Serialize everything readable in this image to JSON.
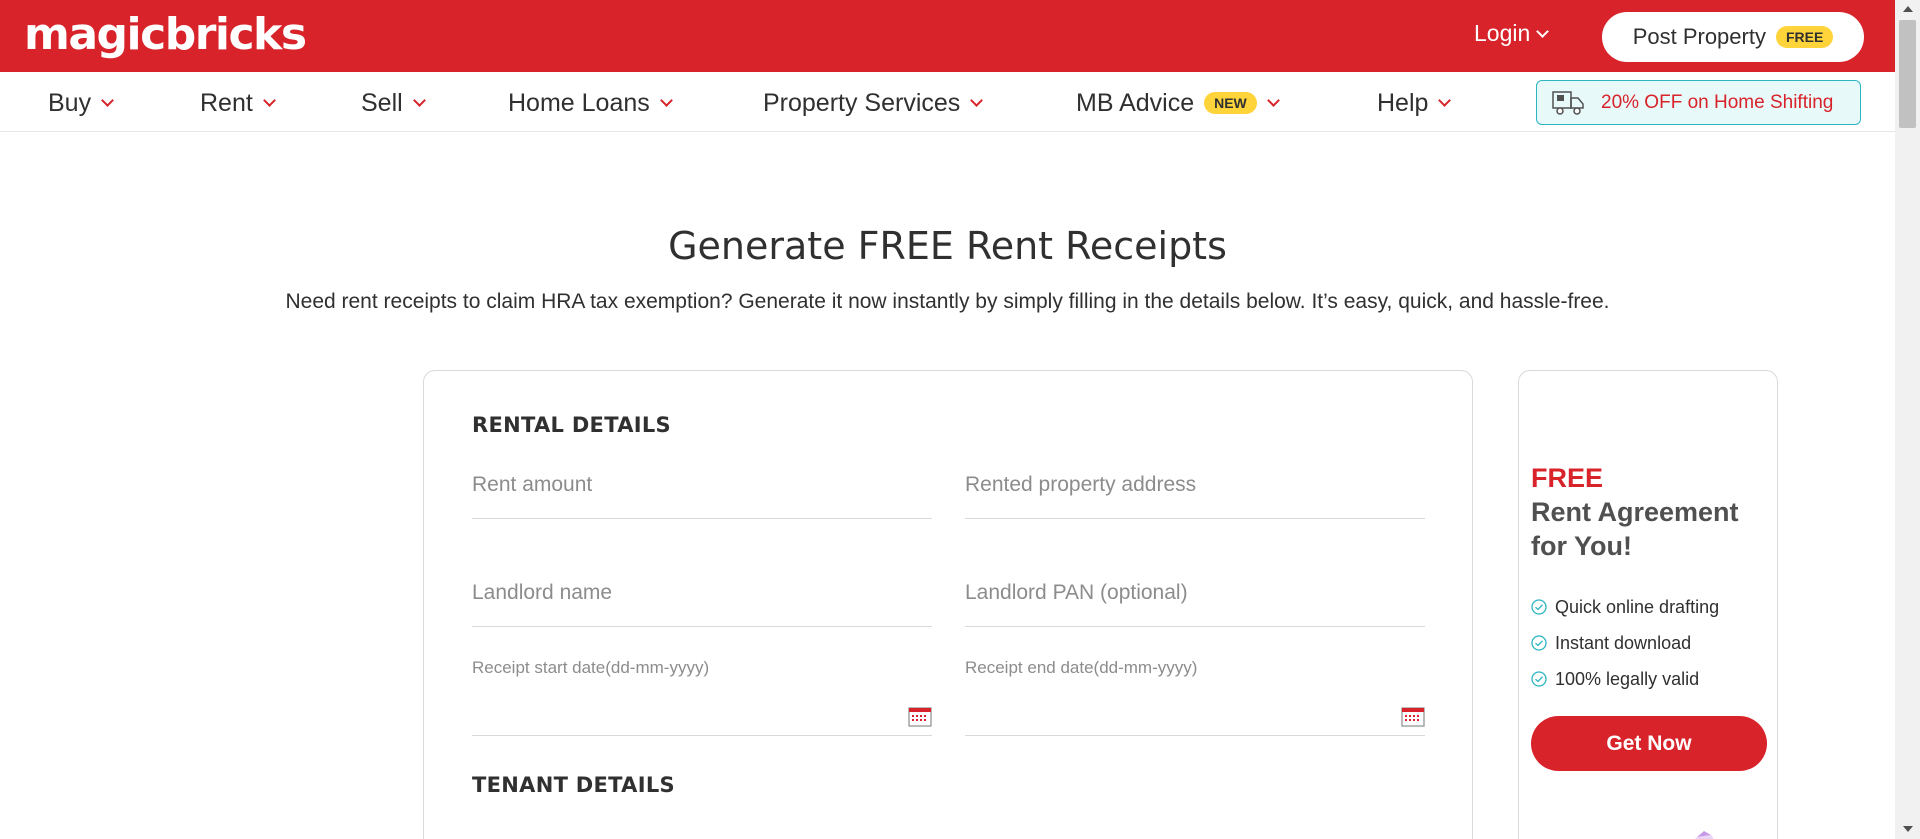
{
  "header": {
    "logo": "magicbricks",
    "login_label": "Login",
    "post_property_label": "Post Property",
    "post_property_badge": "FREE"
  },
  "nav": {
    "items": [
      {
        "label": "Buy"
      },
      {
        "label": "Rent"
      },
      {
        "label": "Sell"
      },
      {
        "label": "Home Loans"
      },
      {
        "label": "Property Services"
      },
      {
        "label": "MB Advice",
        "badge": "NEW"
      },
      {
        "label": "Help"
      }
    ],
    "shifting_offer": "20% OFF on Home Shifting"
  },
  "main": {
    "title": "Generate FREE Rent Receipts",
    "subtitle": "Need rent receipts to claim HRA tax exemption? Generate it now instantly by simply filling in the details below. It’s easy, quick, and hassle-free."
  },
  "form": {
    "rental_section_title": "RENTAL DETAILS",
    "rent_amount_placeholder": "Rent amount",
    "rent_amount_value": "",
    "property_address_placeholder": "Rented property address",
    "property_address_value": "",
    "landlord_name_placeholder": "Landlord name",
    "landlord_name_value": "",
    "landlord_pan_placeholder": "Landlord PAN (optional)",
    "landlord_pan_value": "",
    "start_date_label": "Receipt start date(dd-mm-yyyy)",
    "end_date_label": "Receipt end date(dd-mm-yyyy)",
    "tenant_section_title": "TENANT DETAILS"
  },
  "promo": {
    "free_label": "FREE",
    "headline": "Rent Agreement for You!",
    "features": [
      "Quick online drafting",
      "Instant download",
      "100% legally valid"
    ],
    "cta_label": "Get Now"
  },
  "colors": {
    "brand_red": "#d8232a",
    "badge_yellow": "#ffd43b",
    "teal_accent": "#2ab5c1"
  }
}
